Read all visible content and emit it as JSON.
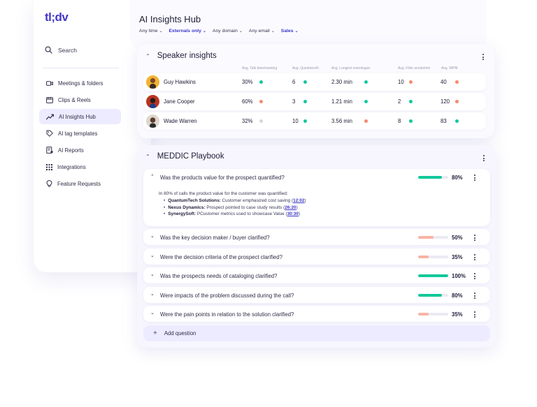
{
  "app": {
    "logo": "tl;dv"
  },
  "sidebar": {
    "search_label": "Search",
    "items": [
      {
        "label": "Meetings & folders",
        "icon": "video-camera-icon",
        "active": false
      },
      {
        "label": "Clips & Reels",
        "icon": "film-icon",
        "active": false
      },
      {
        "label": "AI Insights Hub",
        "icon": "trend-line-icon",
        "active": true
      },
      {
        "label": "AI tag templates",
        "icon": "tag-icon",
        "active": false
      },
      {
        "label": "AI Reports",
        "icon": "report-icon",
        "active": false
      },
      {
        "label": "Integrations",
        "icon": "grid-icon",
        "active": false
      },
      {
        "label": "Feature Requests",
        "icon": "bulb-icon",
        "active": false
      }
    ]
  },
  "header": {
    "title": "AI Insights Hub",
    "filters": [
      {
        "label": "Any time",
        "active": false
      },
      {
        "label": "Externals only",
        "active": true
      },
      {
        "label": "Any domain",
        "active": false
      },
      {
        "label": "Any email",
        "active": false
      },
      {
        "label": "Sales",
        "active": true
      }
    ]
  },
  "speaker_insights": {
    "title": "Speaker insights",
    "columns": [
      "Avg. Talk time/meeting",
      "Avg. Questions/h",
      "Avg. Longest monologue",
      "Avg. Filler words/min",
      "Avg. WPM"
    ],
    "rows": [
      {
        "name": "Guy Hawkins",
        "talk": "30%",
        "talk_status": "green",
        "questions": "6",
        "questions_status": "green",
        "monologue": "2.30 min",
        "monologue_status": "green",
        "filler": "10",
        "filler_status": "orange",
        "wpm": "40",
        "wpm_status": "orange"
      },
      {
        "name": "Jane Cooper",
        "talk": "60%",
        "talk_status": "orange",
        "questions": "3",
        "questions_status": "green",
        "monologue": "1.21 min",
        "monologue_status": "green",
        "filler": "2",
        "filler_status": "green",
        "wpm": "120",
        "wpm_status": "orange"
      },
      {
        "name": "Wade Warren",
        "talk": "32%",
        "talk_status": "gray",
        "questions": "10",
        "questions_status": "green",
        "monologue": "3.56 min",
        "monologue_status": "orange",
        "filler": "8",
        "filler_status": "green",
        "wpm": "83",
        "wpm_status": "green"
      }
    ]
  },
  "meddic": {
    "title": "MEDDIC Playbook",
    "questions": [
      {
        "text": "Was the products value for the prospect quantified?",
        "percent": 80,
        "percent_label": "80%",
        "bar_color": "#12c99b",
        "expanded": true
      },
      {
        "text": "Was the key decision maker / buyer clarified?",
        "percent": 50,
        "percent_label": "50%",
        "bar_color": "#f9b4a4",
        "expanded": false
      },
      {
        "text": "Were the decision criteria of the prospect clarified?",
        "percent": 35,
        "percent_label": "35%",
        "bar_color": "#f9b4a4",
        "expanded": false
      },
      {
        "text": "Was the prospects needs of cataloging clarified?",
        "percent": 100,
        "percent_label": "100%",
        "bar_color": "#12c99b",
        "expanded": false
      },
      {
        "text": "Were impacts of the problem discussed during the call?",
        "percent": 80,
        "percent_label": "80%",
        "bar_color": "#12c99b",
        "expanded": false
      },
      {
        "text": "Were the pain points in relation to the solution clarified?",
        "percent": 35,
        "percent_label": "35%",
        "bar_color": "#f9b4a4",
        "expanded": false
      }
    ],
    "detail": {
      "summary": "In 80% of calls the product value for the customer was quantified:",
      "items": [
        {
          "company": "QuantumTech Solutions:",
          "text": "Customer emphasized cost saving (",
          "time": "12:02",
          "close": ")"
        },
        {
          "company": "Nexus Dynamics:",
          "text": "Prospect pointed to case study results (",
          "time": "26:20",
          "close": ")"
        },
        {
          "company": "SynergySoft:",
          "text": "PCustomer metrics used to showcase Value (",
          "time": "30:30",
          "close": ")"
        }
      ]
    },
    "add_label": "Add question"
  },
  "colors": {
    "accent": "#3b36c9",
    "green": "#12c99b",
    "orange": "#f58a6b",
    "gray": "#d5d4df"
  }
}
